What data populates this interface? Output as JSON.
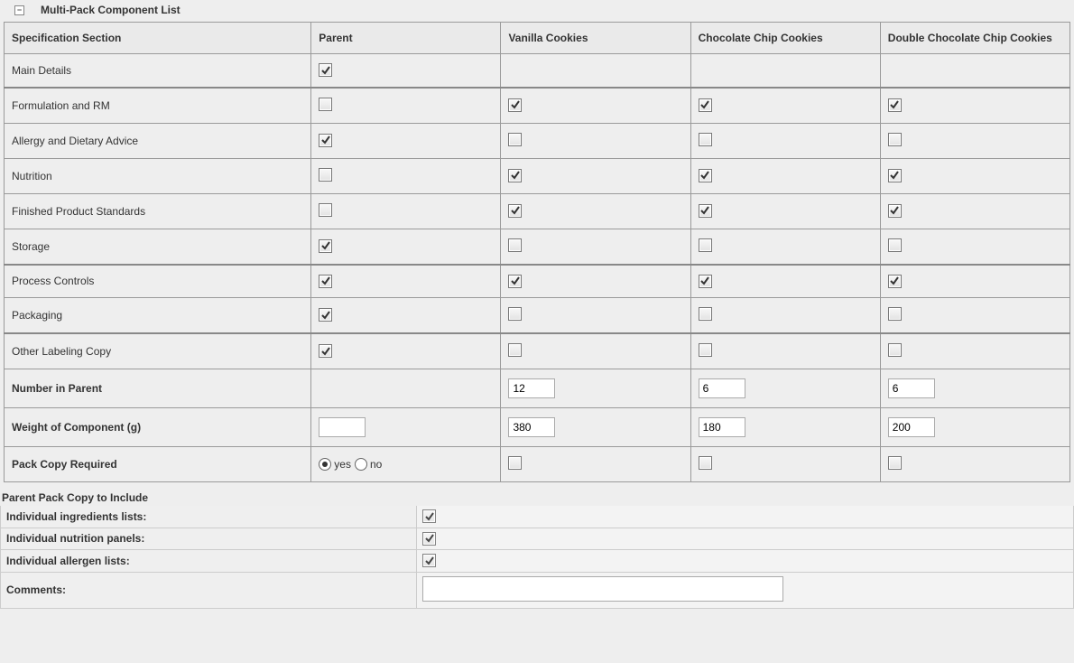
{
  "panel": {
    "title": "Multi-Pack Component List"
  },
  "columns": [
    "Specification Section",
    "Parent",
    "Vanilla Cookies",
    "Chocolate Chip Cookies",
    "Double Chocolate Chip Cookies"
  ],
  "rows": [
    {
      "label": "Main Details",
      "cells": [
        true,
        null,
        null,
        null
      ],
      "group_end": true
    },
    {
      "label": "Formulation and RM",
      "cells": [
        false,
        true,
        true,
        true
      ]
    },
    {
      "label": "Allergy and Dietary Advice",
      "cells": [
        true,
        false,
        false,
        false
      ]
    },
    {
      "label": "Nutrition",
      "cells": [
        false,
        true,
        true,
        true
      ]
    },
    {
      "label": "Finished Product Standards",
      "cells": [
        false,
        true,
        true,
        true
      ]
    },
    {
      "label": "Storage",
      "cells": [
        true,
        false,
        false,
        false
      ],
      "group_end": true
    },
    {
      "label": "Process Controls",
      "cells": [
        true,
        true,
        true,
        true
      ]
    },
    {
      "label": "Packaging",
      "cells": [
        true,
        false,
        false,
        false
      ],
      "group_end": true
    },
    {
      "label": "Other Labeling Copy",
      "cells": [
        true,
        false,
        false,
        false
      ]
    }
  ],
  "number_in_parent": {
    "label": "Number in Parent",
    "values": [
      "",
      "12",
      "6",
      "6"
    ]
  },
  "weight_of_component": {
    "label": "Weight of Component (g)",
    "values": [
      "",
      "380",
      "180",
      "200"
    ]
  },
  "pack_copy_required": {
    "label": "Pack Copy Required",
    "options": [
      "yes",
      "no"
    ],
    "parent_value": "yes",
    "component_checks": [
      false,
      false,
      false
    ]
  },
  "parent_pack_copy": {
    "title": "Parent Pack Copy to Include",
    "individual_ingredients_lists": {
      "label": "Individual ingredients lists:",
      "checked": true
    },
    "individual_nutrition_panels": {
      "label": "Individual nutrition panels:",
      "checked": true
    },
    "individual_allergen_lists": {
      "label": "Individual allergen lists:",
      "checked": true
    }
  },
  "comments": {
    "label": "Comments:",
    "value": ""
  }
}
